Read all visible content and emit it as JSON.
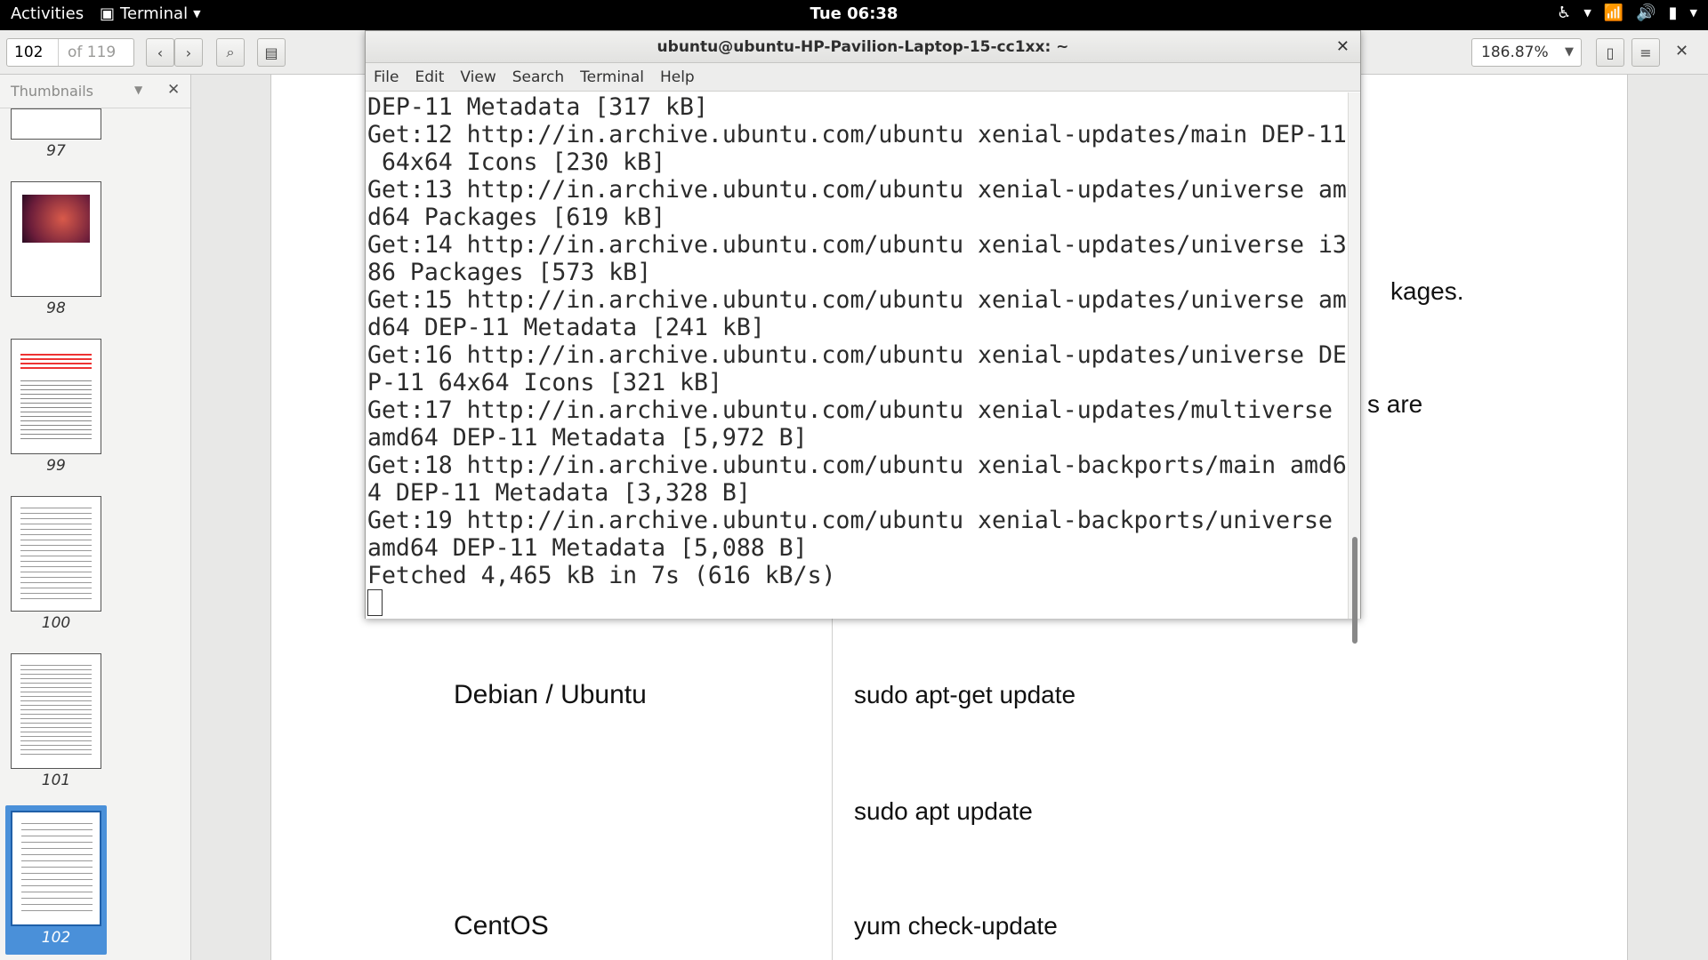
{
  "topbar": {
    "activities": "Activities",
    "app_name": "Terminal",
    "clock": "Tue 06:38"
  },
  "viewer": {
    "current_page": "102",
    "total_pages": "of 119",
    "zoom": "186.87%",
    "sidebar_title": "Thumbnails",
    "thumbnails": [
      {
        "label": "97"
      },
      {
        "label": "98"
      },
      {
        "label": "99"
      },
      {
        "label": "100"
      },
      {
        "label": "101"
      },
      {
        "label": "102"
      }
    ],
    "selected_page": "102",
    "document": {
      "partial_1": "kages.",
      "partial_2": "s are",
      "rows": [
        {
          "os": "Debian / Ubuntu",
          "cmd": "sudo apt-get update"
        },
        {
          "os": "",
          "cmd": "sudo apt update"
        },
        {
          "os": "CentOS",
          "cmd": "yum check-update"
        }
      ]
    }
  },
  "terminal": {
    "title": "ubuntu@ubuntu-HP-Pavilion-Laptop-15-cc1xx: ~",
    "menu": [
      "File",
      "Edit",
      "View",
      "Search",
      "Terminal",
      "Help"
    ],
    "lines": [
      "DEP-11 Metadata [317 kB]",
      "Get:12 http://in.archive.ubuntu.com/ubuntu xenial-updates/main DEP-11",
      " 64x64 Icons [230 kB]",
      "Get:13 http://in.archive.ubuntu.com/ubuntu xenial-updates/universe am",
      "d64 Packages [619 kB]",
      "Get:14 http://in.archive.ubuntu.com/ubuntu xenial-updates/universe i3",
      "86 Packages [573 kB]",
      "Get:15 http://in.archive.ubuntu.com/ubuntu xenial-updates/universe am",
      "d64 DEP-11 Metadata [241 kB]",
      "Get:16 http://in.archive.ubuntu.com/ubuntu xenial-updates/universe DE",
      "P-11 64x64 Icons [321 kB]",
      "Get:17 http://in.archive.ubuntu.com/ubuntu xenial-updates/multiverse",
      "amd64 DEP-11 Metadata [5,972 B]",
      "Get:18 http://in.archive.ubuntu.com/ubuntu xenial-backports/main amd6",
      "4 DEP-11 Metadata [3,328 B]",
      "Get:19 http://in.archive.ubuntu.com/ubuntu xenial-backports/universe",
      "amd64 DEP-11 Metadata [5,088 B]",
      "Fetched 4,465 kB in 7s (616 kB/s)"
    ]
  }
}
